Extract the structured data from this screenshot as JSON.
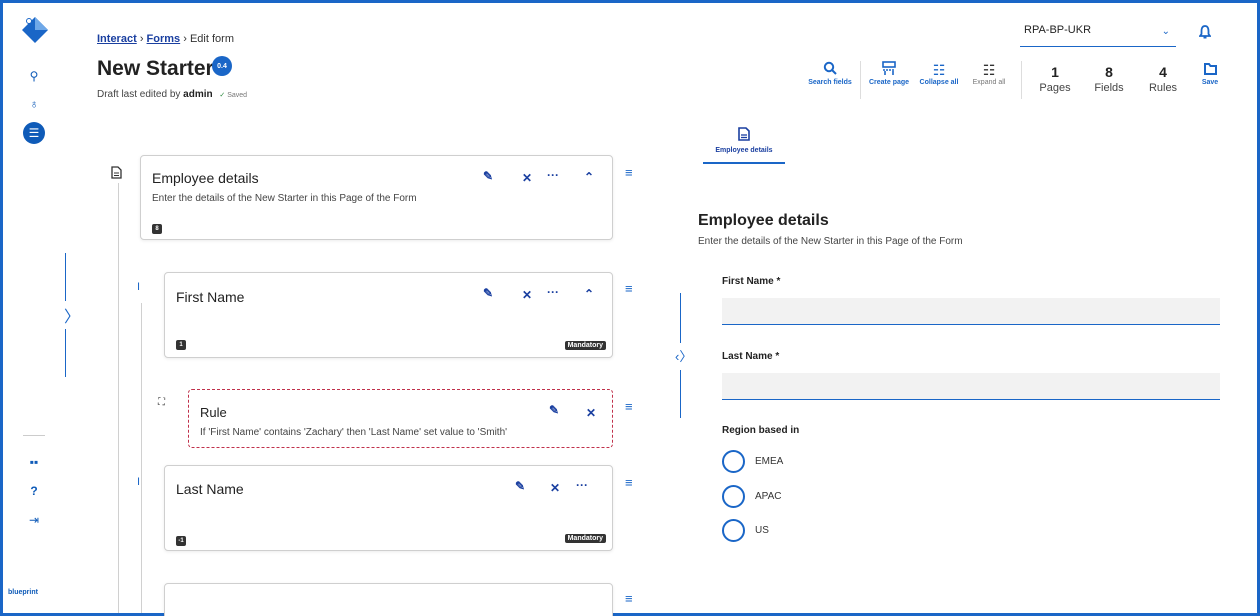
{
  "sidebar": {
    "logo_text": "blueprint"
  },
  "breadcrumb": {
    "interact": "Interact",
    "forms": "Forms",
    "sep1": "›",
    "sep2": "›",
    "current": "Edit form"
  },
  "header": {
    "title": "New Starter",
    "version": "0.4",
    "draft_prefix": "Draft last edited by",
    "user": "admin",
    "saved": "Saved"
  },
  "environment": {
    "selected": "RPA-BP-UKR"
  },
  "toolbar": {
    "search": "Search fields",
    "create_page": "Create page",
    "collapse_all": "Collapse all",
    "expand_all": "Expand all",
    "save": "Save"
  },
  "stats": {
    "pages": {
      "value": "1",
      "label": "Pages"
    },
    "fields": {
      "value": "8",
      "label": "Fields"
    },
    "rules": {
      "value": "4",
      "label": "Rules"
    }
  },
  "tree": {
    "page": {
      "title": "Employee details",
      "description": "Enter the details of the New Starter in this Page of the Form",
      "count": "8"
    },
    "first_name": {
      "title": "First Name",
      "index": "1",
      "badge": "Mandatory"
    },
    "rule": {
      "title": "Rule",
      "description": "If 'First Name' contains 'Zachary' then 'Last Name' set value to 'Smith'"
    },
    "last_name": {
      "title": "Last Name",
      "index": "-1",
      "badge": "Mandatory"
    }
  },
  "preview": {
    "tab_label": "Employee details",
    "title": "Employee details",
    "description": "Enter the details of the New Starter in this Page of the Form",
    "first_name_label": "First Name *",
    "last_name_label": "Last Name *",
    "region_label": "Region based in",
    "region_options": [
      "EMEA",
      "APAC",
      "US"
    ]
  }
}
